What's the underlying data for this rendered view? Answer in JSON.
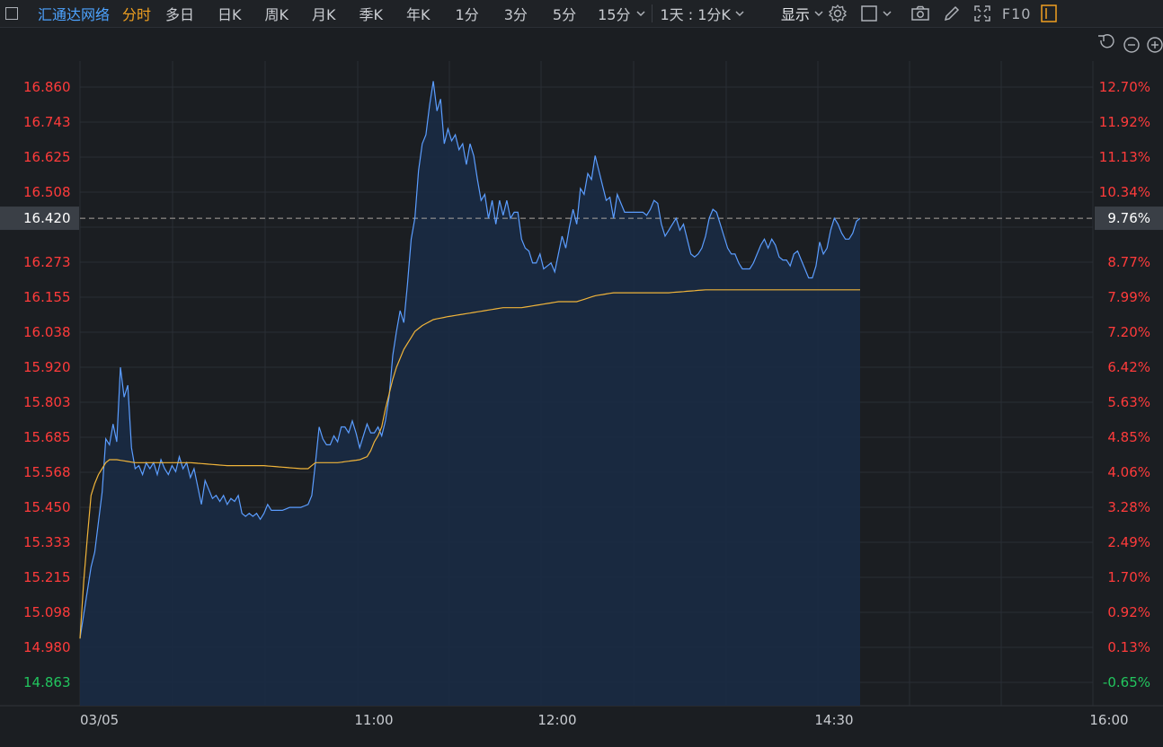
{
  "toolbar": {
    "stock_name": "汇通达网络",
    "tabs": [
      "分时",
      "多日",
      "日K",
      "周K",
      "月K",
      "季K",
      "年K",
      "1分",
      "3分",
      "5分",
      "15分"
    ],
    "active_tab": "分时",
    "period_select": "1天 : 1分K",
    "display_label": "显示",
    "f10_label": "F10"
  },
  "colors": {
    "price_line": "#5b9dff",
    "avg_line": "#f0b43a",
    "up": "#ff3b3b",
    "down": "#22c55e",
    "area_fill": "#1a2a44",
    "grid": "#2a2e34"
  },
  "current_price_label": "16.420",
  "current_pct_label": "9.76%",
  "chart_data": {
    "type": "line",
    "date_label": "03/05",
    "x_ticks": [
      "03/05",
      "11:00",
      "12:00",
      "14:30",
      "16:00"
    ],
    "y_ticks": [
      "16.860",
      "16.743",
      "16.625",
      "16.508",
      "16.420",
      "16.273",
      "16.155",
      "16.038",
      "15.920",
      "15.803",
      "15.685",
      "15.568",
      "15.450",
      "15.333",
      "15.215",
      "15.098",
      "14.980",
      "14.863"
    ],
    "pct_ticks": [
      "12.70%",
      "11.92%",
      "11.13%",
      "10.34%",
      "9.76%",
      "8.77%",
      "7.99%",
      "7.20%",
      "6.42%",
      "5.63%",
      "4.85%",
      "4.06%",
      "3.28%",
      "2.49%",
      "1.70%",
      "0.92%",
      "0.13%",
      "-0.65%"
    ],
    "ylim": [
      14.863,
      16.86
    ],
    "reference_price": 16.42,
    "minutes_total": 270,
    "minutes_drawn": 212,
    "price_anchors": [
      [
        0,
        15.01
      ],
      [
        3,
        15.25
      ],
      [
        4,
        15.3
      ],
      [
        6,
        15.5
      ],
      [
        7,
        15.68
      ],
      [
        8,
        15.66
      ],
      [
        9,
        15.73
      ],
      [
        10,
        15.67
      ],
      [
        11,
        15.92
      ],
      [
        12,
        15.82
      ],
      [
        13,
        15.86
      ],
      [
        14,
        15.65
      ],
      [
        15,
        15.58
      ],
      [
        16,
        15.59
      ],
      [
        17,
        15.56
      ],
      [
        18,
        15.6
      ],
      [
        19,
        15.58
      ],
      [
        20,
        15.6
      ],
      [
        21,
        15.56
      ],
      [
        22,
        15.61
      ],
      [
        23,
        15.58
      ],
      [
        24,
        15.56
      ],
      [
        25,
        15.59
      ],
      [
        26,
        15.57
      ],
      [
        27,
        15.62
      ],
      [
        28,
        15.58
      ],
      [
        29,
        15.6
      ],
      [
        30,
        15.55
      ],
      [
        31,
        15.58
      ],
      [
        32,
        15.52
      ],
      [
        33,
        15.46
      ],
      [
        34,
        15.54
      ],
      [
        35,
        15.51
      ],
      [
        36,
        15.48
      ],
      [
        37,
        15.49
      ],
      [
        38,
        15.47
      ],
      [
        39,
        15.49
      ],
      [
        40,
        15.46
      ],
      [
        41,
        15.48
      ],
      [
        42,
        15.47
      ],
      [
        43,
        15.49
      ],
      [
        44,
        15.43
      ],
      [
        45,
        15.42
      ],
      [
        46,
        15.43
      ],
      [
        47,
        15.42
      ],
      [
        48,
        15.43
      ],
      [
        49,
        15.41
      ],
      [
        50,
        15.43
      ],
      [
        51,
        15.46
      ],
      [
        52,
        15.44
      ],
      [
        53,
        15.44
      ],
      [
        55,
        15.44
      ],
      [
        57,
        15.45
      ],
      [
        60,
        15.45
      ],
      [
        62,
        15.46
      ],
      [
        63,
        15.49
      ],
      [
        64,
        15.6
      ],
      [
        65,
        15.72
      ],
      [
        66,
        15.68
      ],
      [
        67,
        15.66
      ],
      [
        68,
        15.66
      ],
      [
        69,
        15.69
      ],
      [
        70,
        15.67
      ],
      [
        71,
        15.72
      ],
      [
        72,
        15.72
      ],
      [
        73,
        15.7
      ],
      [
        74,
        15.74
      ],
      [
        75,
        15.7
      ],
      [
        76,
        15.65
      ],
      [
        77,
        15.69
      ],
      [
        78,
        15.73
      ],
      [
        79,
        15.7
      ],
      [
        80,
        15.7
      ],
      [
        81,
        15.72
      ],
      [
        82,
        15.69
      ],
      [
        83,
        15.74
      ],
      [
        84,
        15.82
      ],
      [
        85,
        15.96
      ],
      [
        86,
        16.04
      ],
      [
        87,
        16.11
      ],
      [
        88,
        16.07
      ],
      [
        89,
        16.2
      ],
      [
        90,
        16.35
      ],
      [
        91,
        16.42
      ],
      [
        92,
        16.58
      ],
      [
        93,
        16.67
      ],
      [
        94,
        16.7
      ],
      [
        95,
        16.8
      ],
      [
        96,
        16.88
      ],
      [
        97,
        16.78
      ],
      [
        98,
        16.82
      ],
      [
        99,
        16.67
      ],
      [
        100,
        16.72
      ],
      [
        101,
        16.68
      ],
      [
        102,
        16.7
      ],
      [
        103,
        16.65
      ],
      [
        104,
        16.67
      ],
      [
        105,
        16.6
      ],
      [
        106,
        16.67
      ],
      [
        107,
        16.63
      ],
      [
        108,
        16.55
      ],
      [
        109,
        16.48
      ],
      [
        110,
        16.5
      ],
      [
        111,
        16.42
      ],
      [
        112,
        16.48
      ],
      [
        113,
        16.4
      ],
      [
        114,
        16.48
      ],
      [
        115,
        16.43
      ],
      [
        116,
        16.48
      ],
      [
        117,
        16.42
      ],
      [
        118,
        16.44
      ],
      [
        119,
        16.44
      ],
      [
        120,
        16.35
      ],
      [
        121,
        16.32
      ],
      [
        122,
        16.31
      ],
      [
        123,
        16.27
      ],
      [
        124,
        16.27
      ],
      [
        125,
        16.3
      ],
      [
        126,
        16.25
      ],
      [
        127,
        16.26
      ],
      [
        128,
        16.27
      ],
      [
        129,
        16.24
      ],
      [
        130,
        16.3
      ],
      [
        131,
        16.36
      ],
      [
        132,
        16.32
      ],
      [
        133,
        16.39
      ],
      [
        134,
        16.45
      ],
      [
        135,
        16.4
      ],
      [
        136,
        16.52
      ],
      [
        137,
        16.5
      ],
      [
        138,
        16.57
      ],
      [
        139,
        16.55
      ],
      [
        140,
        16.63
      ],
      [
        141,
        16.58
      ],
      [
        142,
        16.53
      ],
      [
        143,
        16.48
      ],
      [
        144,
        16.49
      ],
      [
        145,
        16.42
      ],
      [
        146,
        16.5
      ],
      [
        147,
        16.47
      ],
      [
        148,
        16.44
      ],
      [
        149,
        16.44
      ],
      [
        150,
        16.44
      ],
      [
        151,
        16.44
      ],
      [
        152,
        16.44
      ],
      [
        153,
        16.44
      ],
      [
        154,
        16.43
      ],
      [
        155,
        16.45
      ],
      [
        156,
        16.48
      ],
      [
        157,
        16.47
      ],
      [
        158,
        16.4
      ],
      [
        159,
        16.36
      ],
      [
        160,
        16.38
      ],
      [
        161,
        16.4
      ],
      [
        162,
        16.42
      ],
      [
        163,
        16.38
      ],
      [
        164,
        16.4
      ],
      [
        165,
        16.35
      ],
      [
        166,
        16.3
      ],
      [
        167,
        16.29
      ],
      [
        168,
        16.3
      ],
      [
        169,
        16.32
      ],
      [
        170,
        16.36
      ],
      [
        171,
        16.42
      ],
      [
        172,
        16.45
      ],
      [
        173,
        16.44
      ],
      [
        174,
        16.4
      ],
      [
        175,
        16.36
      ],
      [
        176,
        16.32
      ],
      [
        177,
        16.3
      ],
      [
        178,
        16.3
      ],
      [
        179,
        16.27
      ],
      [
        180,
        16.25
      ],
      [
        181,
        16.25
      ],
      [
        182,
        16.25
      ],
      [
        183,
        16.27
      ],
      [
        184,
        16.3
      ],
      [
        185,
        16.33
      ],
      [
        186,
        16.35
      ],
      [
        187,
        16.32
      ],
      [
        188,
        16.35
      ],
      [
        189,
        16.33
      ],
      [
        190,
        16.29
      ],
      [
        191,
        16.28
      ],
      [
        192,
        16.28
      ],
      [
        193,
        16.26
      ],
      [
        194,
        16.3
      ],
      [
        195,
        16.31
      ],
      [
        196,
        16.28
      ],
      [
        197,
        16.25
      ],
      [
        198,
        16.22
      ],
      [
        199,
        16.22
      ],
      [
        200,
        16.26
      ],
      [
        201,
        16.34
      ],
      [
        202,
        16.3
      ],
      [
        203,
        16.32
      ],
      [
        204,
        16.38
      ],
      [
        205,
        16.42
      ],
      [
        206,
        16.4
      ],
      [
        207,
        16.37
      ],
      [
        208,
        16.35
      ],
      [
        209,
        16.35
      ],
      [
        210,
        16.37
      ],
      [
        211,
        16.41
      ],
      [
        212,
        16.42
      ]
    ],
    "avg_anchors": [
      [
        0,
        15.01
      ],
      [
        1,
        15.2
      ],
      [
        2,
        15.35
      ],
      [
        3,
        15.49
      ],
      [
        4,
        15.53
      ],
      [
        5,
        15.56
      ],
      [
        6,
        15.58
      ],
      [
        7,
        15.6
      ],
      [
        8,
        15.61
      ],
      [
        10,
        15.61
      ],
      [
        15,
        15.6
      ],
      [
        20,
        15.6
      ],
      [
        30,
        15.6
      ],
      [
        40,
        15.59
      ],
      [
        50,
        15.59
      ],
      [
        60,
        15.58
      ],
      [
        62,
        15.58
      ],
      [
        64,
        15.6
      ],
      [
        70,
        15.6
      ],
      [
        76,
        15.61
      ],
      [
        78,
        15.62
      ],
      [
        79,
        15.64
      ],
      [
        80,
        15.67
      ],
      [
        81,
        15.69
      ],
      [
        82,
        15.72
      ],
      [
        83,
        15.78
      ],
      [
        84,
        15.83
      ],
      [
        85,
        15.88
      ],
      [
        86,
        15.92
      ],
      [
        87,
        15.95
      ],
      [
        88,
        15.98
      ],
      [
        89,
        16.0
      ],
      [
        90,
        16.02
      ],
      [
        91,
        16.04
      ],
      [
        93,
        16.06
      ],
      [
        96,
        16.08
      ],
      [
        100,
        16.09
      ],
      [
        105,
        16.1
      ],
      [
        110,
        16.11
      ],
      [
        115,
        16.12
      ],
      [
        120,
        16.12
      ],
      [
        125,
        16.13
      ],
      [
        130,
        16.14
      ],
      [
        135,
        16.14
      ],
      [
        140,
        16.16
      ],
      [
        145,
        16.17
      ],
      [
        150,
        16.17
      ],
      [
        160,
        16.17
      ],
      [
        170,
        16.18
      ],
      [
        180,
        16.18
      ],
      [
        190,
        16.18
      ],
      [
        200,
        16.18
      ],
      [
        212,
        16.18
      ]
    ]
  }
}
